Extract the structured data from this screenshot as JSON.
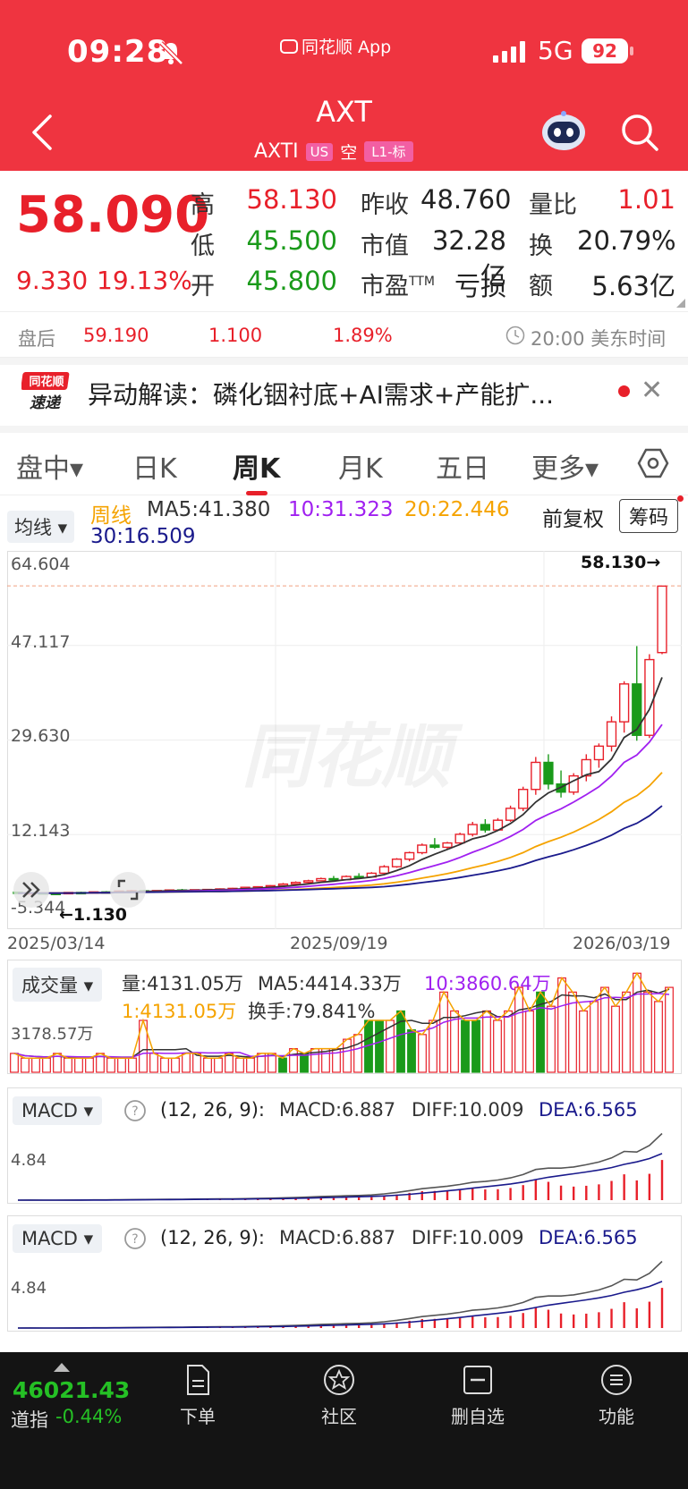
{
  "status": {
    "time": "09:28",
    "app_label": "同花顺 App",
    "network": "5G",
    "battery": "92"
  },
  "header": {
    "title": "AXT",
    "ticker": "AXTI",
    "market_badge": "US",
    "short_tag": "空",
    "level_badge": "L1-标"
  },
  "quote": {
    "price": "58.090",
    "change": "9.330",
    "change_pct": "19.13%",
    "high_label": "高",
    "high": "58.130",
    "low_label": "低",
    "low": "45.500",
    "open_label": "开",
    "open": "45.800",
    "prev_close_label": "昨收",
    "prev_close": "48.760",
    "mkt_cap_label": "市值",
    "mkt_cap": "32.28亿",
    "pe_label": "市盈",
    "pe_sup": "TTM",
    "pe": "亏损",
    "vol_ratio_label": "量比",
    "vol_ratio": "1.01",
    "turnover_label": "换",
    "turnover": "20.79%",
    "amount_label": "额",
    "amount": "5.63亿"
  },
  "after_hours": {
    "label": "盘后",
    "price": "59.190",
    "change": "1.100",
    "change_pct": "1.89%",
    "time": "20:00 美东时间"
  },
  "news": {
    "logo_top": "同花顺",
    "logo_bottom": "速递",
    "text": "异动解读：磷化铟衬底+AI需求+产能扩..."
  },
  "tabs": [
    {
      "label": "盘中▾"
    },
    {
      "label": "日K"
    },
    {
      "label": "周K"
    },
    {
      "label": "月K"
    },
    {
      "label": "五日"
    },
    {
      "label": "更多▾"
    }
  ],
  "ma": {
    "selector": "均线 ▾",
    "line_label": "周线",
    "ma5": "MA5:41.380",
    "ma10": "10:31.323",
    "ma20": "20:22.446",
    "ma30": "30:16.509",
    "adjust": "前复权",
    "chips": "筹码"
  },
  "chart_data": {
    "type": "candlestick",
    "y_ticks": [
      "64.604",
      "47.117",
      "29.630",
      "12.143",
      "-5.344"
    ],
    "x_labels": [
      "2025/03/14",
      "2025/09/19",
      "2026/03/19"
    ],
    "max_label": "58.130→",
    "min_label": "←1.130",
    "watermark": "同花顺",
    "ylim": [
      -5.344,
      64.604
    ],
    "candles": [
      [
        1.5,
        1.6,
        1.2,
        1.3
      ],
      [
        1.3,
        1.5,
        1.2,
        1.4
      ],
      [
        1.4,
        1.5,
        1.2,
        1.3
      ],
      [
        1.3,
        1.4,
        1.13,
        1.25
      ],
      [
        1.25,
        1.5,
        1.2,
        1.45
      ],
      [
        1.45,
        1.6,
        1.3,
        1.4
      ],
      [
        1.4,
        1.6,
        1.3,
        1.55
      ],
      [
        1.55,
        1.7,
        1.4,
        1.5
      ],
      [
        1.5,
        1.8,
        1.4,
        1.7
      ],
      [
        1.7,
        1.9,
        1.6,
        1.75
      ],
      [
        1.75,
        1.9,
        1.6,
        1.7
      ],
      [
        1.7,
        1.85,
        1.55,
        1.8
      ],
      [
        1.8,
        2.0,
        1.7,
        1.9
      ],
      [
        1.9,
        2.1,
        1.8,
        1.85
      ],
      [
        1.85,
        2.0,
        1.7,
        1.95
      ],
      [
        1.95,
        2.1,
        1.8,
        2.0
      ],
      [
        2.0,
        2.2,
        1.9,
        2.1
      ],
      [
        2.1,
        2.3,
        2.0,
        2.2
      ],
      [
        2.2,
        2.5,
        2.1,
        2.4
      ],
      [
        2.4,
        2.6,
        2.3,
        2.5
      ],
      [
        2.5,
        2.8,
        2.4,
        2.7
      ],
      [
        2.7,
        3.2,
        2.6,
        3.0
      ],
      [
        3.0,
        3.5,
        2.9,
        3.3
      ],
      [
        3.3,
        3.8,
        3.2,
        3.6
      ],
      [
        3.6,
        4.2,
        3.5,
        4.0
      ],
      [
        4.0,
        4.5,
        3.6,
        3.8
      ],
      [
        3.8,
        4.6,
        3.7,
        4.4
      ],
      [
        4.4,
        5.0,
        4.1,
        4.3
      ],
      [
        4.3,
        5.2,
        4.2,
        5.0
      ],
      [
        5.0,
        6.5,
        4.9,
        6.2
      ],
      [
        6.2,
        7.8,
        6.0,
        7.6
      ],
      [
        7.6,
        9.0,
        7.2,
        8.8
      ],
      [
        8.8,
        10.5,
        8.5,
        10.2
      ],
      [
        10.2,
        11.5,
        9.5,
        9.8
      ],
      [
        9.8,
        10.8,
        9.5,
        10.6
      ],
      [
        10.6,
        12.5,
        10.3,
        12.2
      ],
      [
        12.2,
        14.5,
        11.8,
        14.0
      ],
      [
        14.0,
        15.0,
        12.5,
        13.0
      ],
      [
        13.0,
        15.2,
        12.8,
        14.8
      ],
      [
        14.8,
        17.5,
        14.5,
        17.0
      ],
      [
        17.0,
        21.0,
        16.5,
        20.5
      ],
      [
        20.5,
        26.5,
        19.5,
        25.5
      ],
      [
        25.5,
        27.0,
        20.5,
        21.5
      ],
      [
        21.5,
        24.0,
        19.0,
        20.0
      ],
      [
        20.0,
        23.5,
        19.5,
        23.0
      ],
      [
        23.0,
        27.0,
        22.0,
        26.0
      ],
      [
        26.0,
        29.0,
        24.5,
        28.5
      ],
      [
        28.5,
        34.0,
        27.5,
        33.0
      ],
      [
        33.0,
        40.5,
        31.0,
        40.0
      ],
      [
        40.0,
        47.0,
        29.5,
        30.5
      ],
      [
        30.5,
        45.5,
        30.0,
        44.5
      ],
      [
        45.8,
        58.13,
        45.5,
        58.09
      ]
    ]
  },
  "volume": {
    "selector": "成交量 ▾",
    "amount": "量:4131.05万",
    "ma5": "MA5:4414.33万",
    "ma10": "10:3860.64万",
    "ma1": "1:4131.05万",
    "turnover": "换手:79.841%",
    "tick": "3178.57万",
    "bars": [
      4,
      3,
      3,
      3,
      4,
      3,
      3,
      3,
      4,
      3,
      3,
      3,
      11,
      4,
      3,
      3,
      4,
      4,
      3,
      3,
      4,
      3,
      3,
      4,
      4,
      3,
      5,
      4,
      5,
      5,
      5,
      7,
      8,
      11,
      11,
      11,
      13,
      9,
      8,
      11,
      17,
      13,
      11,
      11,
      13,
      11,
      13,
      18,
      13,
      17,
      14,
      20,
      17,
      13,
      15,
      18,
      14,
      17,
      21,
      17,
      15,
      18
    ],
    "green_idx": [
      25,
      27,
      33,
      34,
      36,
      37,
      42,
      43,
      49
    ]
  },
  "macd1": {
    "selector": "MACD ▾",
    "params": "(12, 26, 9):",
    "macd": "MACD:6.887",
    "diff": "DIFF:10.009",
    "dea": "DEA:6.565",
    "tick": "4.84"
  },
  "macd2": {
    "selector": "MACD ▾",
    "params": "(12, 26, 9):",
    "macd": "MACD:6.887",
    "diff": "DIFF:10.009",
    "dea": "DEA:6.565",
    "tick": "4.84"
  },
  "bottom_bar": {
    "index_value": "46021.43",
    "index_name": "道指",
    "index_change": "-0.44%",
    "items": [
      {
        "label": "下单"
      },
      {
        "label": "社区"
      },
      {
        "label": "删自选"
      },
      {
        "label": "功能"
      }
    ]
  },
  "colors": {
    "brand_red": "#ef3440",
    "up": "#e8202a",
    "down": "#1a9a1a",
    "ma5": "#333333",
    "ma10": "#a020f0",
    "ma20": "#f5a300",
    "ma30": "#1a1a8c"
  }
}
